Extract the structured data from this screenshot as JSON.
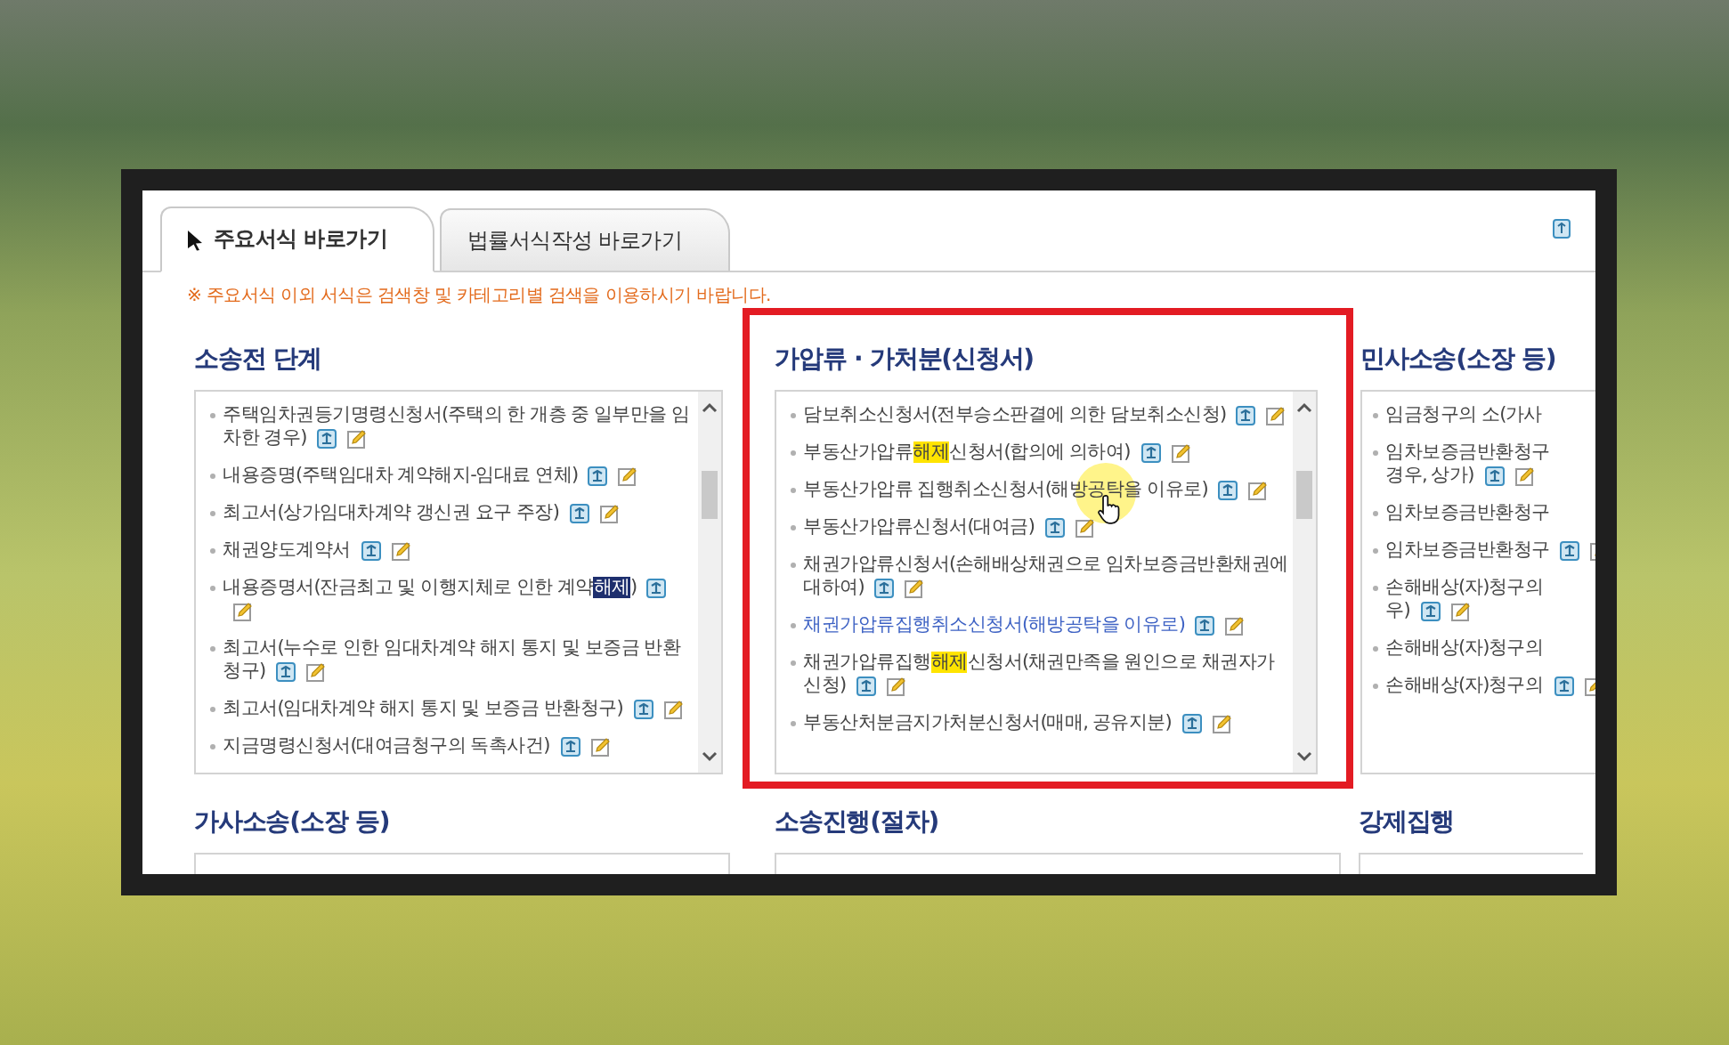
{
  "tabs": [
    {
      "label": "주요서식 바로가기",
      "selected": true
    },
    {
      "label": "법률서식작성 바로가기",
      "selected": false
    }
  ],
  "notice": "※ 주요서식 이외 서식은 검색창 및 카테고리별 검색을 이용하시기 바랍니다.",
  "sections": [
    {
      "title": "소송전 단계",
      "emphasized": false,
      "items": [
        {
          "segments": [
            {
              "text": "주택임차권등기명령신청서(주택의 한 개층 중 일부만을 임차한 경우)",
              "kind": "plain"
            }
          ],
          "icons": true,
          "hovered": false,
          "under_cursor": false
        },
        {
          "segments": [
            {
              "text": "내용증명(주택임대차 계약해지-임대료 연체)",
              "kind": "plain"
            }
          ],
          "icons": true,
          "hovered": false,
          "under_cursor": false
        },
        {
          "segments": [
            {
              "text": "최고서(상가임대차계약 갱신권 요구 주장)",
              "kind": "plain"
            }
          ],
          "icons": true,
          "hovered": false,
          "under_cursor": false
        },
        {
          "segments": [
            {
              "text": "채권양도계약서",
              "kind": "plain"
            }
          ],
          "icons": true,
          "hovered": false,
          "under_cursor": false
        },
        {
          "segments": [
            {
              "text": "내용증명서(잔금최고 및 이행지체로 인한 계약",
              "kind": "plain"
            },
            {
              "text": "해제",
              "kind": "selection"
            },
            {
              "text": ")",
              "kind": "plain"
            }
          ],
          "icons": true,
          "hovered": false,
          "under_cursor": false
        },
        {
          "segments": [
            {
              "text": "최고서(누수로 인한 임대차계약 해지 통지 및 보증금 반환청구)",
              "kind": "plain"
            }
          ],
          "icons": true,
          "hovered": false,
          "under_cursor": false
        },
        {
          "segments": [
            {
              "text": "최고서(임대차계약 해지 통지 및 보증금 반환청구)",
              "kind": "plain"
            }
          ],
          "icons": true,
          "hovered": false,
          "under_cursor": false
        },
        {
          "segments": [
            {
              "text": "지금명령신청서(대여금청구의 독촉사건)",
              "kind": "plain"
            }
          ],
          "icons": true,
          "hovered": false,
          "under_cursor": false
        }
      ]
    },
    {
      "title": "가압류 · 가처분(신청서)",
      "emphasized": true,
      "items": [
        {
          "segments": [
            {
              "text": "담보취소신청서(전부승소판결에 의한 담보취소신청)",
              "kind": "plain"
            }
          ],
          "icons": true,
          "hovered": false,
          "under_cursor": false
        },
        {
          "segments": [
            {
              "text": "부동산가압류",
              "kind": "plain"
            },
            {
              "text": "해제",
              "kind": "highlight"
            },
            {
              "text": "신청서(합의에 의하여)",
              "kind": "plain"
            }
          ],
          "icons": true,
          "hovered": false,
          "under_cursor": false
        },
        {
          "segments": [
            {
              "text": "부동산가압류 집행취소신청서(해방공탁을 이유로)",
              "kind": "plain"
            }
          ],
          "icons": true,
          "hovered": false,
          "under_cursor": true
        },
        {
          "segments": [
            {
              "text": "부동산가압류신청서(대여금)",
              "kind": "plain"
            }
          ],
          "icons": true,
          "hovered": false,
          "under_cursor": false
        },
        {
          "segments": [
            {
              "text": "채권가압류신청서(손해배상채권으로 임차보증금반환채권에 대하여)",
              "kind": "plain"
            }
          ],
          "icons": true,
          "hovered": false,
          "under_cursor": false
        },
        {
          "segments": [
            {
              "text": "채권가압류집행취소신청서(해방공탁을 이유로)",
              "kind": "plain"
            }
          ],
          "icons": true,
          "hovered": true,
          "under_cursor": false
        },
        {
          "segments": [
            {
              "text": "채권가압류집행",
              "kind": "plain"
            },
            {
              "text": "해제",
              "kind": "highlight"
            },
            {
              "text": "신청서(채권만족을 원인으로 채권자가 신청)",
              "kind": "plain"
            }
          ],
          "icons": true,
          "hovered": false,
          "under_cursor": false
        },
        {
          "segments": [
            {
              "text": "부동산처분금지가처분신청서(매매, 공유지분)",
              "kind": "plain"
            }
          ],
          "icons": true,
          "hovered": false,
          "under_cursor": false
        }
      ]
    },
    {
      "title": "민사소송(소장 등)",
      "emphasized": false,
      "items": [
        {
          "lines": [
            "임금청구의 소(가사"
          ],
          "icons": false,
          "hovered": false,
          "under_cursor": false
        },
        {
          "lines": [
            "임차보증금반환청구",
            "경우, 상가)"
          ],
          "icons": true,
          "hovered": false,
          "under_cursor": false
        },
        {
          "lines": [
            "임차보증금반환청구"
          ],
          "icons": false,
          "hovered": false,
          "under_cursor": false
        },
        {
          "lines": [
            "임차보증금반환청구"
          ],
          "icons": true,
          "hovered": false,
          "under_cursor": false
        },
        {
          "lines": [
            "손해배상(자)청구의",
            "우)"
          ],
          "icons": true,
          "hovered": false,
          "under_cursor": false
        },
        {
          "lines": [
            "손해배상(자)청구의"
          ],
          "icons": false,
          "hovered": false,
          "under_cursor": false
        },
        {
          "lines": [
            "손해배상(자)청구의"
          ],
          "icons": true,
          "hovered": false,
          "under_cursor": false
        }
      ]
    }
  ],
  "lower_sections": [
    {
      "title": "가사소송(소장 등)"
    },
    {
      "title": "소송진행(절차)"
    },
    {
      "title": "강제집행"
    }
  ]
}
